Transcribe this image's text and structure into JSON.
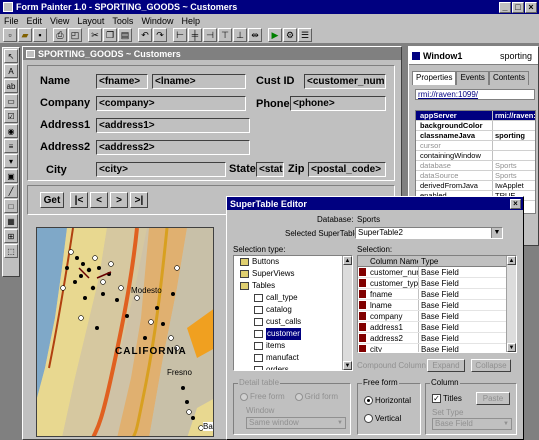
{
  "app": {
    "title": "Form Painter 1.0 - SPORTING_GOODS ~ Customers",
    "menu": [
      "File",
      "Edit",
      "View",
      "Layout",
      "Tools",
      "Window",
      "Help"
    ],
    "title_buttons": [
      "_",
      "□",
      "×"
    ]
  },
  "form": {
    "title": "SPORTING_GOODS ~ Customers",
    "labels": {
      "name": "Name",
      "company": "Company",
      "address1": "Address1",
      "address2": "Address2",
      "city": "City",
      "custid": "Cust ID",
      "phone": "Phone",
      "state": "State",
      "zip": "Zip"
    },
    "fields": {
      "fname": "<fname>",
      "lname": "<lname>",
      "company": "<company>",
      "address1": "<address1>",
      "address2": "<address2>",
      "city": "<city>",
      "custid": "<customer_num",
      "phone": "<phone>",
      "state": "<stat",
      "zip": "<postal_code>"
    },
    "nav": {
      "get": "Get",
      "first": "|<",
      "prev": "<",
      "next": ">",
      "last": ">|"
    },
    "map": {
      "labels": {
        "region": "CALIFORNIA",
        "city1": "Modesto",
        "city2": "Fresno",
        "city3": "Bake"
      }
    }
  },
  "window1": {
    "title": "Window1",
    "name_value": "sporting",
    "tabs": [
      "Properties",
      "Events",
      "Contents"
    ],
    "url": "rmi://raven:1099/",
    "properties": [
      {
        "k": "appServer",
        "v": "rmi://raven:",
        "bold": true,
        "selected": true
      },
      {
        "k": "backgroundColor",
        "v": "",
        "bold": true
      },
      {
        "k": "classnameJava",
        "v": "sporting",
        "bold": true
      },
      {
        "k": "cursor",
        "v": "",
        "gray": true
      },
      {
        "k": "containingWindow",
        "v": ""
      },
      {
        "k": "database",
        "v": "Sports",
        "gray": true
      },
      {
        "k": "dataSource",
        "v": "Sports",
        "gray": true
      },
      {
        "k": "derivedFromJava",
        "v": "IwApplet"
      },
      {
        "k": "enabled",
        "v": "TRUE"
      }
    ]
  },
  "editor": {
    "title": "SuperTable Editor",
    "database_label": "Database:",
    "database_value": "Sports",
    "selected_label": "Selected SuperTable:",
    "selected_value": "SuperTable2",
    "selection_type_label": "Selection type:",
    "selection_label": "Selection:",
    "tree": [
      {
        "label": "Buttons",
        "level": 1
      },
      {
        "label": "SuperViews",
        "level": 1
      },
      {
        "label": "Tables",
        "level": 1
      },
      {
        "label": "call_type",
        "level": 2
      },
      {
        "label": "catalog",
        "level": 2
      },
      {
        "label": "cust_calls",
        "level": 2
      },
      {
        "label": "customer",
        "level": 2,
        "selected": true
      },
      {
        "label": "items",
        "level": 2
      },
      {
        "label": "manufact",
        "level": 2
      },
      {
        "label": "orders",
        "level": 2
      }
    ],
    "columns_header": [
      "Column Name",
      "Type"
    ],
    "columns": [
      {
        "name": "customer_num",
        "type": "Base Field"
      },
      {
        "name": "customer_type",
        "type": "Base Field"
      },
      {
        "name": "fname",
        "type": "Base Field"
      },
      {
        "name": "lname",
        "type": "Base Field"
      },
      {
        "name": "company",
        "type": "Base Field"
      },
      {
        "name": "address1",
        "type": "Base Field"
      },
      {
        "name": "address2",
        "type": "Base Field"
      },
      {
        "name": "city",
        "type": "Base Field"
      }
    ],
    "compound_column": "Compound Column",
    "expand": "Expand",
    "collapse": "Collapse",
    "detail_table": "Detail table",
    "free_form": "Free form",
    "grid_form": "Grid form",
    "window_label": "Window",
    "window_value": "Same window",
    "free_form_group": "Free form",
    "horizontal": "Horizontal",
    "vertical": "Vertical",
    "column_group": "Column",
    "titles": "Titles",
    "paste": "Paste",
    "set_type": "Set Type",
    "set_type_value": "Base Field"
  },
  "colors": {
    "title_active": "#000080",
    "title_inactive": "#808080",
    "face": "#c0c0c0"
  }
}
